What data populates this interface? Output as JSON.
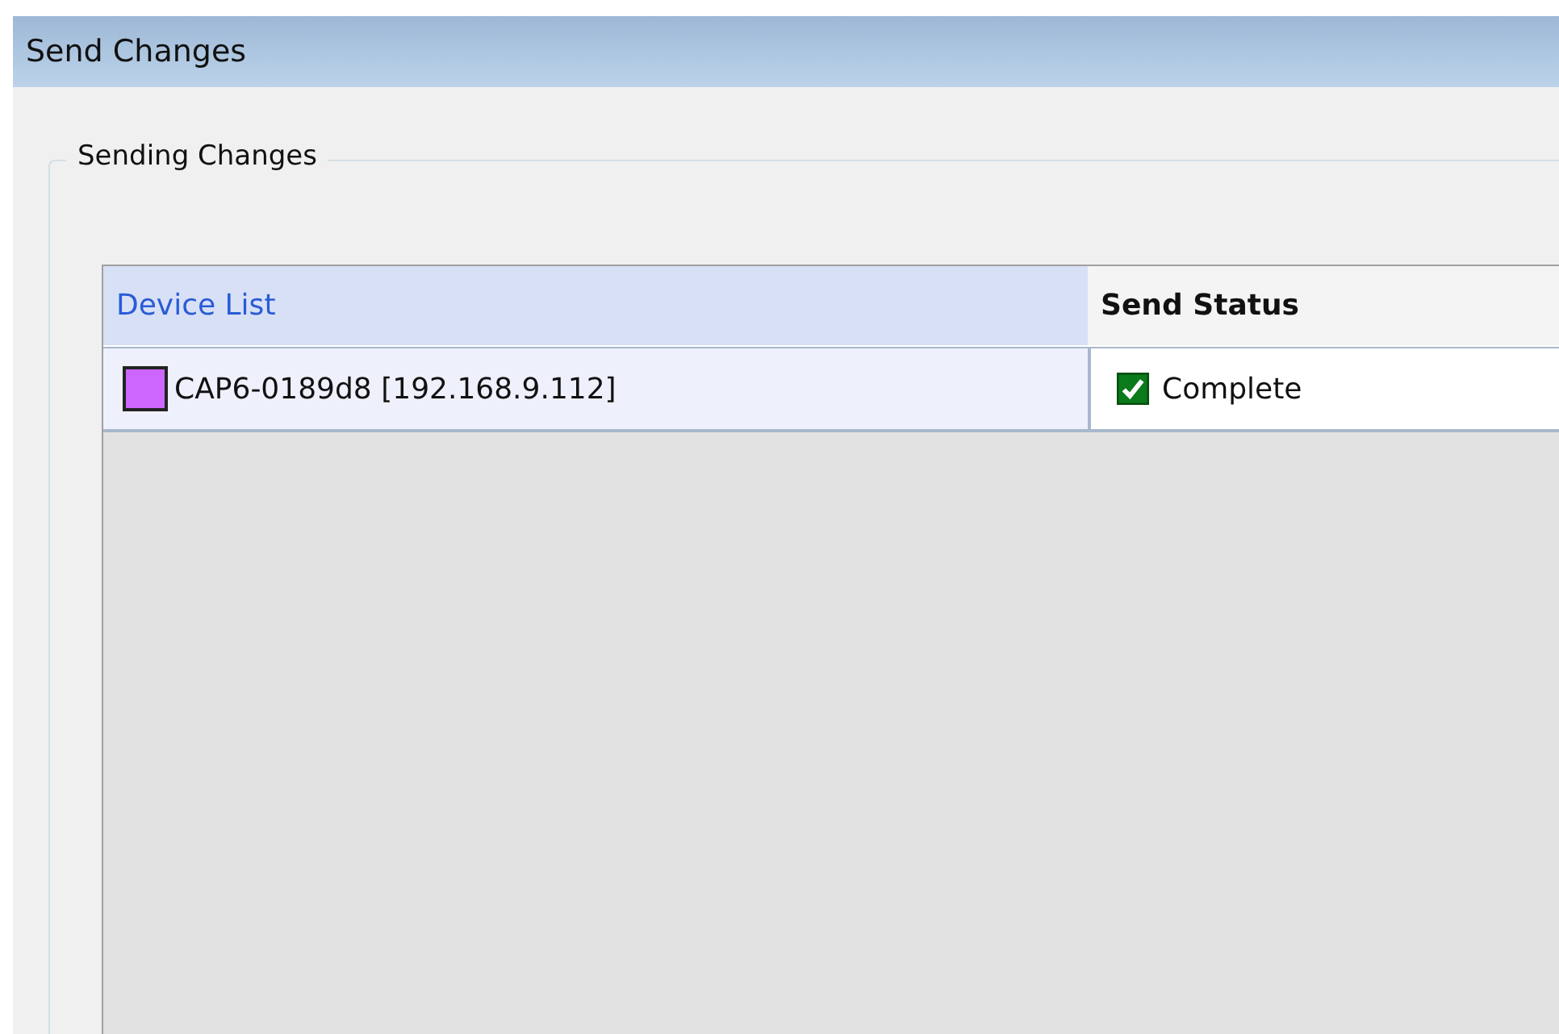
{
  "window": {
    "title": "Send Changes"
  },
  "group": {
    "label": "Sending Changes"
  },
  "table": {
    "columns": [
      {
        "label": "Device List",
        "selected": true
      },
      {
        "label": "Send Status",
        "selected": false
      }
    ],
    "rows": [
      {
        "device": "CAP6-0189d8 [192.168.9.112]",
        "color": "#cc66ff",
        "status": "Complete",
        "complete": true
      }
    ]
  }
}
